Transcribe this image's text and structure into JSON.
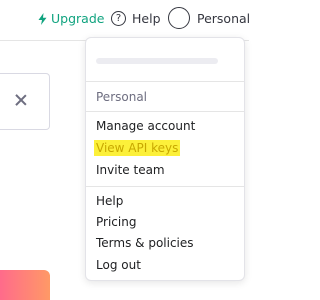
{
  "topbar": {
    "upgrade_label": "Upgrade",
    "help_label": "Help",
    "help_icon_glyph": "?",
    "account_label": "Personal"
  },
  "menu": {
    "section_label": "Personal",
    "items_top": [
      "Manage account",
      "View API keys",
      "Invite team"
    ],
    "items_bottom": [
      "Help",
      "Pricing",
      "Terms & policies",
      "Log out"
    ]
  },
  "colors": {
    "accent": "#10a37f",
    "highlight": "#fcf03a"
  },
  "icons": [
    "bolt-icon",
    "help-circle-icon",
    "avatar-circle",
    "close-icon"
  ]
}
